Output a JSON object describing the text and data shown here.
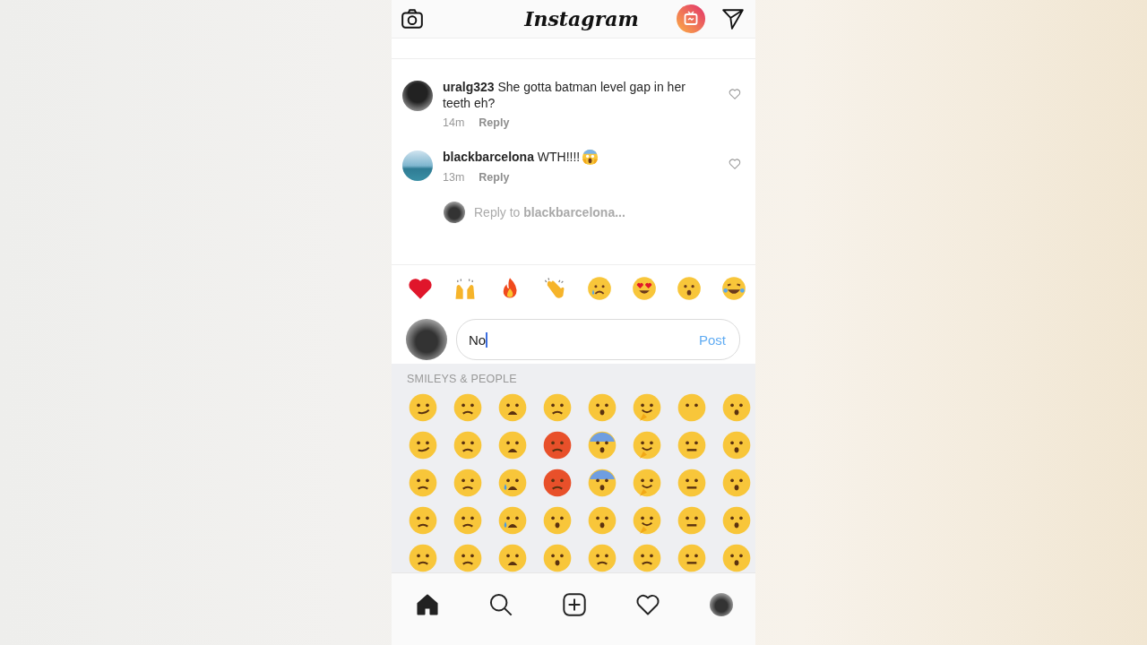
{
  "header": {
    "logo": "Instagram"
  },
  "comments": [
    {
      "username": "uralg323",
      "text": "She gotta batman level gap in her teeth eh?",
      "time": "14m",
      "reply_label": "Reply",
      "has_emoji": false
    },
    {
      "username": "blackbarcelona",
      "text": "WTH!!!!",
      "has_emoji": true,
      "time": "13m",
      "reply_label": "Reply"
    }
  ],
  "reply_prompt": {
    "prefix": "Reply to",
    "username": "blackbarcelona..."
  },
  "quick_reactions": [
    {
      "kind": "heart"
    },
    {
      "kind": "raised-hands"
    },
    {
      "kind": "fire"
    },
    {
      "kind": "clap"
    },
    {
      "kind": "cry"
    },
    {
      "kind": "heart-eyes"
    },
    {
      "kind": "surprised"
    },
    {
      "kind": "laugh"
    }
  ],
  "composer": {
    "value": "No",
    "post_label": "Post"
  },
  "emoji_keyboard": {
    "section_title": "SMILEYS & PEOPLE"
  },
  "bottom_nav": [
    {
      "kind": "home",
      "selected": true
    },
    {
      "kind": "search",
      "selected": false
    },
    {
      "kind": "add",
      "selected": false
    },
    {
      "kind": "heart",
      "selected": false
    },
    {
      "kind": "profile",
      "selected": false
    }
  ]
}
